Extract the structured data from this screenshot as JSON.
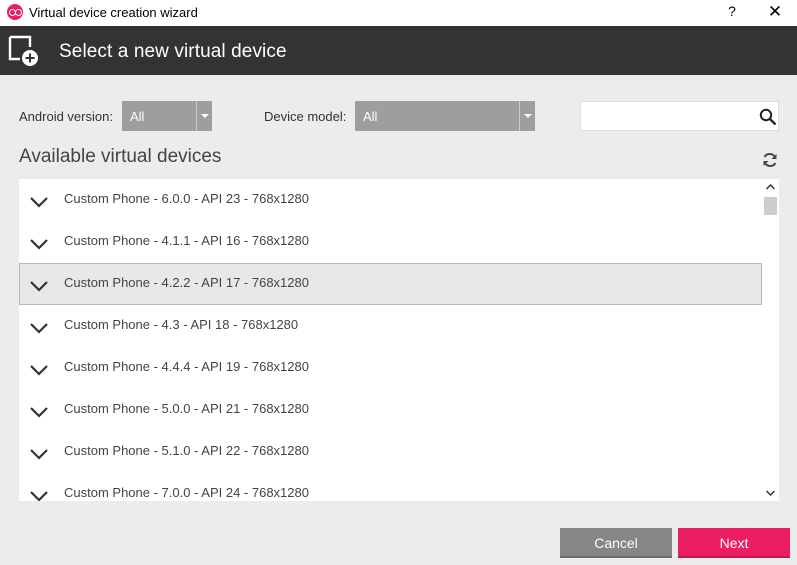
{
  "window": {
    "title": "Virtual device creation wizard",
    "help": "?",
    "close": "✕"
  },
  "header": {
    "title": "Select a new virtual device"
  },
  "filters": {
    "android_version_label": "Android version:",
    "android_version_value": "All",
    "device_model_label": "Device model:",
    "device_model_value": "All",
    "search_value": "",
    "search_placeholder": ""
  },
  "section": {
    "title": "Available virtual devices"
  },
  "devices": [
    {
      "label": "Custom Phone - 6.0.0 - API 23 - 768x1280",
      "selected": false
    },
    {
      "label": "Custom Phone - 4.1.1 - API 16 - 768x1280",
      "selected": false
    },
    {
      "label": "Custom Phone - 4.2.2 - API 17 - 768x1280",
      "selected": true
    },
    {
      "label": "Custom Phone - 4.3 - API 18 - 768x1280",
      "selected": false
    },
    {
      "label": "Custom Phone - 4.4.4 - API 19 - 768x1280",
      "selected": false
    },
    {
      "label": "Custom Phone - 5.0.0 - API 21 - 768x1280",
      "selected": false
    },
    {
      "label": "Custom Phone - 5.1.0 - API 22 - 768x1280",
      "selected": false
    },
    {
      "label": "Custom Phone - 7.0.0 - API 24 - 768x1280",
      "selected": false
    }
  ],
  "buttons": {
    "cancel": "Cancel",
    "next": "Next"
  },
  "colors": {
    "header_bg": "#333333",
    "accent": "#e91e63",
    "select_bg": "#9e9e9e",
    "cancel_bg": "#868686"
  },
  "icons": {
    "app": "genymotion-icon",
    "header": "add-device-icon",
    "search": "search-icon",
    "refresh": "refresh-icon",
    "expand": "chevron-down-icon"
  }
}
